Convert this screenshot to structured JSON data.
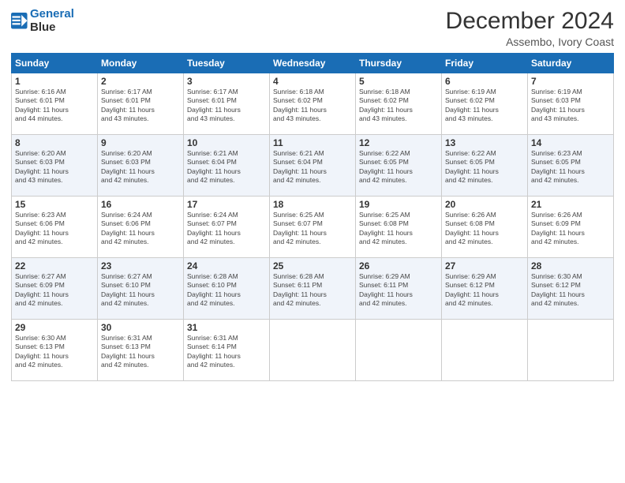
{
  "logo": {
    "line1": "General",
    "line2": "Blue"
  },
  "title": "December 2024",
  "location": "Assembo, Ivory Coast",
  "days_of_week": [
    "Sunday",
    "Monday",
    "Tuesday",
    "Wednesday",
    "Thursday",
    "Friday",
    "Saturday"
  ],
  "weeks": [
    [
      {
        "day": "1",
        "detail": "Sunrise: 6:16 AM\nSunset: 6:01 PM\nDaylight: 11 hours\nand 44 minutes."
      },
      {
        "day": "2",
        "detail": "Sunrise: 6:17 AM\nSunset: 6:01 PM\nDaylight: 11 hours\nand 43 minutes."
      },
      {
        "day": "3",
        "detail": "Sunrise: 6:17 AM\nSunset: 6:01 PM\nDaylight: 11 hours\nand 43 minutes."
      },
      {
        "day": "4",
        "detail": "Sunrise: 6:18 AM\nSunset: 6:02 PM\nDaylight: 11 hours\nand 43 minutes."
      },
      {
        "day": "5",
        "detail": "Sunrise: 6:18 AM\nSunset: 6:02 PM\nDaylight: 11 hours\nand 43 minutes."
      },
      {
        "day": "6",
        "detail": "Sunrise: 6:19 AM\nSunset: 6:02 PM\nDaylight: 11 hours\nand 43 minutes."
      },
      {
        "day": "7",
        "detail": "Sunrise: 6:19 AM\nSunset: 6:03 PM\nDaylight: 11 hours\nand 43 minutes."
      }
    ],
    [
      {
        "day": "8",
        "detail": "Sunrise: 6:20 AM\nSunset: 6:03 PM\nDaylight: 11 hours\nand 43 minutes."
      },
      {
        "day": "9",
        "detail": "Sunrise: 6:20 AM\nSunset: 6:03 PM\nDaylight: 11 hours\nand 42 minutes."
      },
      {
        "day": "10",
        "detail": "Sunrise: 6:21 AM\nSunset: 6:04 PM\nDaylight: 11 hours\nand 42 minutes."
      },
      {
        "day": "11",
        "detail": "Sunrise: 6:21 AM\nSunset: 6:04 PM\nDaylight: 11 hours\nand 42 minutes."
      },
      {
        "day": "12",
        "detail": "Sunrise: 6:22 AM\nSunset: 6:05 PM\nDaylight: 11 hours\nand 42 minutes."
      },
      {
        "day": "13",
        "detail": "Sunrise: 6:22 AM\nSunset: 6:05 PM\nDaylight: 11 hours\nand 42 minutes."
      },
      {
        "day": "14",
        "detail": "Sunrise: 6:23 AM\nSunset: 6:05 PM\nDaylight: 11 hours\nand 42 minutes."
      }
    ],
    [
      {
        "day": "15",
        "detail": "Sunrise: 6:23 AM\nSunset: 6:06 PM\nDaylight: 11 hours\nand 42 minutes."
      },
      {
        "day": "16",
        "detail": "Sunrise: 6:24 AM\nSunset: 6:06 PM\nDaylight: 11 hours\nand 42 minutes."
      },
      {
        "day": "17",
        "detail": "Sunrise: 6:24 AM\nSunset: 6:07 PM\nDaylight: 11 hours\nand 42 minutes."
      },
      {
        "day": "18",
        "detail": "Sunrise: 6:25 AM\nSunset: 6:07 PM\nDaylight: 11 hours\nand 42 minutes."
      },
      {
        "day": "19",
        "detail": "Sunrise: 6:25 AM\nSunset: 6:08 PM\nDaylight: 11 hours\nand 42 minutes."
      },
      {
        "day": "20",
        "detail": "Sunrise: 6:26 AM\nSunset: 6:08 PM\nDaylight: 11 hours\nand 42 minutes."
      },
      {
        "day": "21",
        "detail": "Sunrise: 6:26 AM\nSunset: 6:09 PM\nDaylight: 11 hours\nand 42 minutes."
      }
    ],
    [
      {
        "day": "22",
        "detail": "Sunrise: 6:27 AM\nSunset: 6:09 PM\nDaylight: 11 hours\nand 42 minutes."
      },
      {
        "day": "23",
        "detail": "Sunrise: 6:27 AM\nSunset: 6:10 PM\nDaylight: 11 hours\nand 42 minutes."
      },
      {
        "day": "24",
        "detail": "Sunrise: 6:28 AM\nSunset: 6:10 PM\nDaylight: 11 hours\nand 42 minutes."
      },
      {
        "day": "25",
        "detail": "Sunrise: 6:28 AM\nSunset: 6:11 PM\nDaylight: 11 hours\nand 42 minutes."
      },
      {
        "day": "26",
        "detail": "Sunrise: 6:29 AM\nSunset: 6:11 PM\nDaylight: 11 hours\nand 42 minutes."
      },
      {
        "day": "27",
        "detail": "Sunrise: 6:29 AM\nSunset: 6:12 PM\nDaylight: 11 hours\nand 42 minutes."
      },
      {
        "day": "28",
        "detail": "Sunrise: 6:30 AM\nSunset: 6:12 PM\nDaylight: 11 hours\nand 42 minutes."
      }
    ],
    [
      {
        "day": "29",
        "detail": "Sunrise: 6:30 AM\nSunset: 6:13 PM\nDaylight: 11 hours\nand 42 minutes."
      },
      {
        "day": "30",
        "detail": "Sunrise: 6:31 AM\nSunset: 6:13 PM\nDaylight: 11 hours\nand 42 minutes."
      },
      {
        "day": "31",
        "detail": "Sunrise: 6:31 AM\nSunset: 6:14 PM\nDaylight: 11 hours\nand 42 minutes."
      },
      {
        "day": "",
        "detail": ""
      },
      {
        "day": "",
        "detail": ""
      },
      {
        "day": "",
        "detail": ""
      },
      {
        "day": "",
        "detail": ""
      }
    ]
  ]
}
